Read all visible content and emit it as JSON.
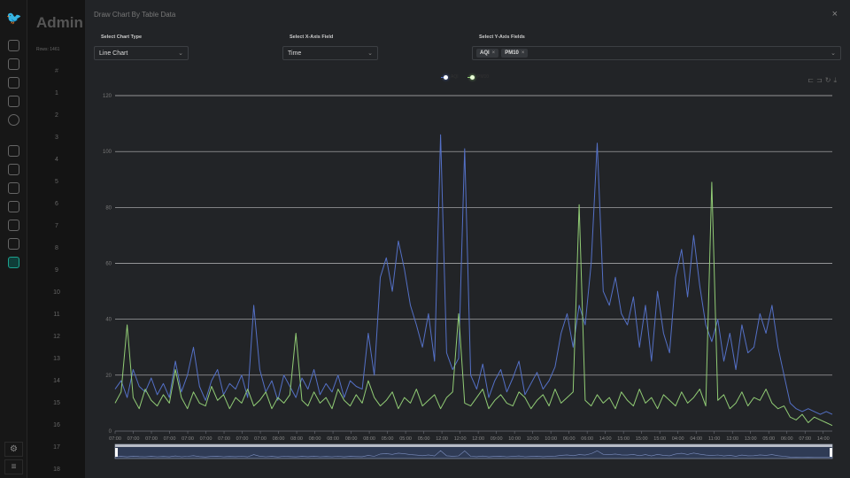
{
  "sidebar": {
    "icons": [
      "logo-bird-icon",
      "dashboard-icon",
      "settings-chip-icon",
      "badge-icon",
      "user-icon",
      "power-icon",
      "chip-icon",
      "person-icon",
      "building-icon",
      "calendar-icon",
      "bookmark-icon",
      "flask-icon",
      "chart-icon"
    ],
    "active": "chart-icon",
    "bottom": [
      "settings-gear-icon",
      "menu-icon"
    ]
  },
  "background_page": {
    "title": "Admin",
    "rows_label": "Rows: 1461",
    "col_hash": "#",
    "row_numbers": [
      "1",
      "2",
      "3",
      "4",
      "5",
      "6",
      "7",
      "8",
      "9",
      "10",
      "11",
      "12",
      "13",
      "14",
      "15",
      "16",
      "17",
      "18"
    ]
  },
  "modal": {
    "title": "Draw Chart By Table Data",
    "close": "×",
    "chart_type": {
      "label": "Select Chart Type",
      "value": "Line Chart"
    },
    "x_field": {
      "label": "Select X-Axis Field",
      "value": "Time"
    },
    "y_fields": {
      "label": "Select Y-Axis Fields",
      "tags": [
        "AQI",
        "PM10"
      ]
    },
    "toolbox": [
      "zoom-icon",
      "zoom-reset-icon",
      "restore-icon",
      "download-icon"
    ]
  },
  "colors": {
    "AQI": "#5470c6",
    "PM10": "#91cc75",
    "grid": "#e0e0e0",
    "background": "#222427"
  },
  "chart_data": {
    "type": "line",
    "ylim": [
      0,
      120
    ],
    "yticks": [
      0,
      20,
      40,
      60,
      80,
      100,
      120
    ],
    "grid": true,
    "legend_placement": "top-center",
    "xtick_labels": [
      "07:00",
      "07:00",
      "07:00",
      "07:00",
      "07:00",
      "07:00",
      "07:00",
      "07:00",
      "07:00",
      "08:00",
      "08:00",
      "08:00",
      "08:00",
      "08:00",
      "08:00",
      "05:00",
      "05:00",
      "05:00",
      "12:00",
      "12:00",
      "12:00",
      "09:00",
      "10:00",
      "10:00",
      "10:00",
      "06:00",
      "06:00",
      "14:00",
      "15:00",
      "15:00",
      "15:00",
      "04:00",
      "04:00",
      "11:00",
      "13:00",
      "13:00",
      "05:00",
      "06:00",
      "07:00",
      "14:00"
    ],
    "series": [
      {
        "name": "AQI",
        "values": [
          15,
          18,
          12,
          22,
          16,
          14,
          19,
          13,
          17,
          12,
          25,
          14,
          20,
          30,
          16,
          11,
          18,
          22,
          13,
          17,
          15,
          20,
          12,
          45,
          22,
          14,
          18,
          11,
          20,
          16,
          12,
          19,
          15,
          22,
          13,
          17,
          14,
          20,
          12,
          18,
          16,
          15,
          35,
          20,
          55,
          62,
          50,
          68,
          58,
          45,
          38,
          30,
          42,
          25,
          106,
          28,
          22,
          26,
          101,
          20,
          15,
          24,
          12,
          18,
          22,
          14,
          19,
          25,
          13,
          17,
          21,
          15,
          18,
          23,
          35,
          42,
          30,
          45,
          38,
          60,
          103,
          50,
          45,
          55,
          42,
          38,
          48,
          30,
          45,
          25,
          50,
          35,
          28,
          55,
          65,
          48,
          70,
          52,
          38,
          32,
          40,
          25,
          35,
          22,
          38,
          28,
          30,
          42,
          35,
          45,
          30,
          20,
          10,
          8,
          7,
          8,
          7,
          6,
          7,
          6
        ]
      },
      {
        "name": "PM10",
        "values": [
          10,
          14,
          38,
          12,
          8,
          15,
          11,
          9,
          13,
          10,
          22,
          12,
          8,
          14,
          10,
          9,
          16,
          11,
          13,
          8,
          12,
          10,
          15,
          9,
          11,
          14,
          8,
          12,
          10,
          13,
          35,
          11,
          9,
          14,
          10,
          12,
          8,
          15,
          11,
          9,
          13,
          10,
          18,
          12,
          9,
          11,
          14,
          8,
          12,
          10,
          15,
          9,
          11,
          13,
          8,
          12,
          14,
          42,
          10,
          9,
          12,
          15,
          8,
          11,
          13,
          10,
          9,
          14,
          12,
          8,
          11,
          13,
          9,
          15,
          10,
          12,
          14,
          81,
          11,
          9,
          13,
          10,
          12,
          8,
          14,
          11,
          9,
          15,
          10,
          12,
          8,
          13,
          11,
          9,
          14,
          10,
          12,
          15,
          9,
          89,
          11,
          13,
          8,
          10,
          14,
          9,
          12,
          11,
          15,
          10,
          8,
          9,
          5,
          4,
          6,
          3,
          5,
          4,
          3,
          2
        ]
      }
    ]
  }
}
